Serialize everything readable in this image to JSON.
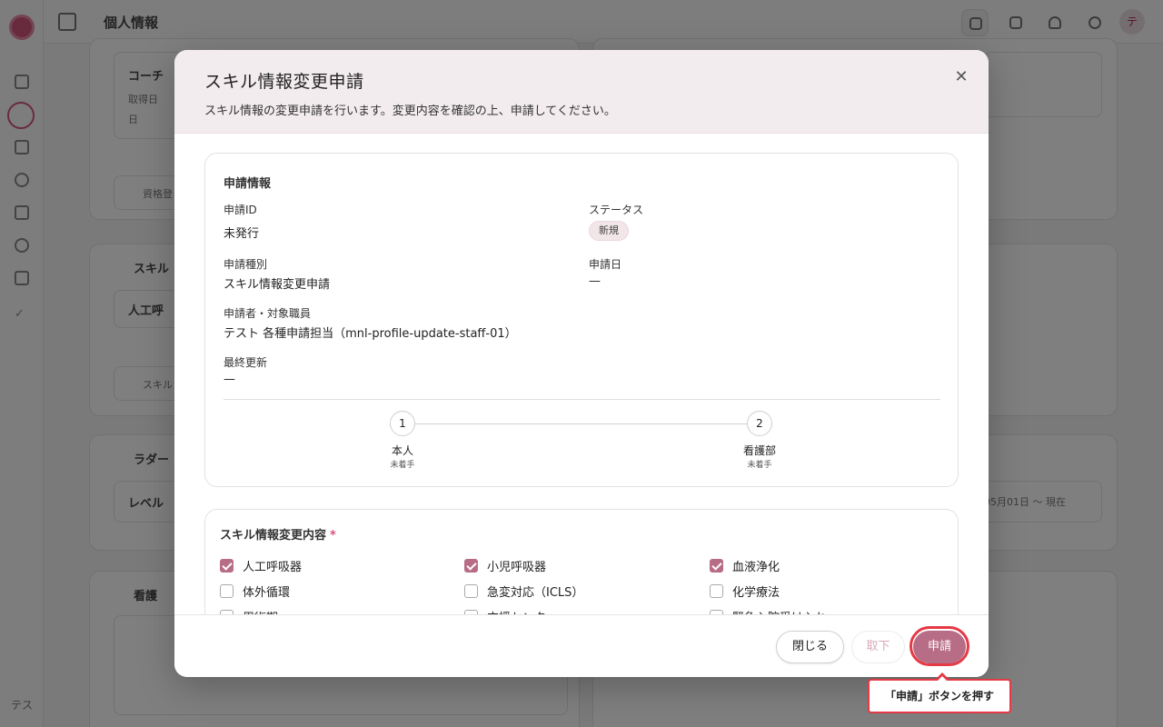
{
  "background": {
    "page_title": "個人情報",
    "cards": {
      "coach": "コーチ",
      "coach_sub1": "取得日",
      "coach_sub2": "日",
      "pending": "資格登",
      "skills": "スキル",
      "skill_item": "人工呼",
      "skill_change": "スキル",
      "ladder": "ラダー",
      "level": "レベル",
      "nursing": "看護",
      "date_range": "05月01日 〜 現在"
    },
    "user_initials": "テス",
    "avatar_initial": "テ"
  },
  "modal": {
    "title": "スキル情報変更申請",
    "description": "スキル情報の変更申請を行います。変更内容を確認の上、申請してください。",
    "close_symbol": "✕",
    "application_info": {
      "section_title": "申請情報",
      "id_label": "申請ID",
      "id_value": "未発行",
      "status_label": "ステータス",
      "status_value": "新規",
      "type_label": "申請種別",
      "type_value": "スキル情報変更申請",
      "date_label": "申請日",
      "date_value": "—",
      "applicant_label": "申請者・対象職員",
      "applicant_value": "テスト 各種申請担当（mnl-profile-update-staff-01）",
      "updated_label": "最終更新",
      "updated_value": "—"
    },
    "steps": [
      {
        "number": "1",
        "label": "本人",
        "status": "未着手"
      },
      {
        "number": "2",
        "label": "看護部",
        "status": "未着手"
      }
    ],
    "skills": {
      "section_title": "スキル情報変更内容",
      "required_mark": "*",
      "items": [
        {
          "label": "人工呼吸器",
          "checked": true
        },
        {
          "label": "小児呼吸器",
          "checked": true
        },
        {
          "label": "血液浄化",
          "checked": true
        },
        {
          "label": "体外循環",
          "checked": false
        },
        {
          "label": "急変対応（ICLS）",
          "checked": false
        },
        {
          "label": "化学療法",
          "checked": false
        },
        {
          "label": "周術期",
          "checked": false
        },
        {
          "label": "支援センター",
          "checked": false
        },
        {
          "label": "緊急入院受け入れ",
          "checked": false
        }
      ]
    },
    "footer": {
      "close_label": "閉じる",
      "withdraw_label": "取下",
      "submit_label": "申請"
    }
  },
  "callout": {
    "text": "「申請」ボタンを押す",
    "color": "#e53945"
  },
  "colors": {
    "accent": "#b86d86",
    "brand": "#d0567a"
  }
}
